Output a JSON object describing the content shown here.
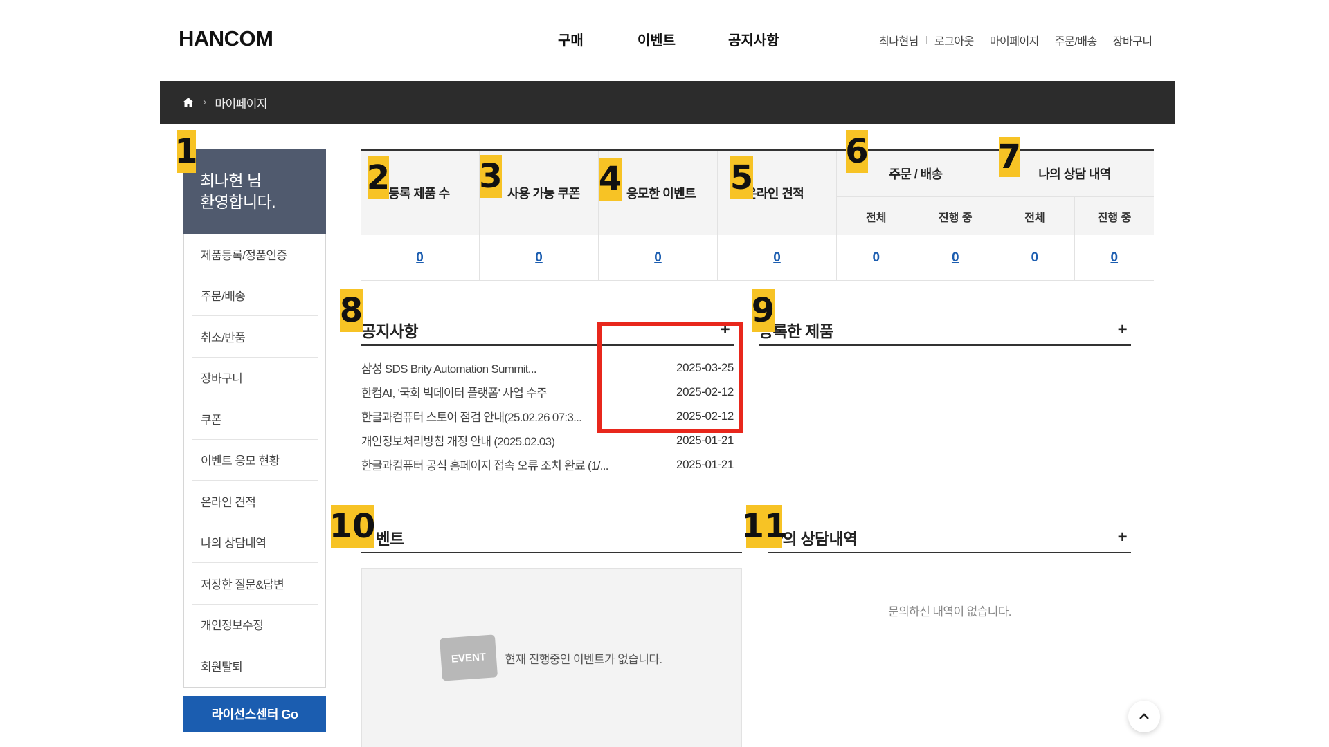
{
  "header": {
    "logo": "HANCOM",
    "nav": [
      "구매",
      "이벤트",
      "공지사항"
    ],
    "util": [
      "최나현님",
      "로그아웃",
      "마이페이지",
      "주문/배송",
      "장바구니"
    ]
  },
  "breadcrumb": {
    "current": "마이페이지"
  },
  "sidebar": {
    "welcome_line1": "최나현 님",
    "welcome_line2": "환영합니다.",
    "items": [
      "제품등록/정품인증",
      "주문/배송",
      "취소/반품",
      "장바구니",
      "쿠폰",
      "이벤트 응모 현황",
      "온라인 견적",
      "나의 상담내역",
      "저장한 질문&답변",
      "개인정보수정",
      "회원탈퇴"
    ],
    "license_button": "라이선스센터 Go"
  },
  "stats": {
    "registered": {
      "label": "등록 제품 수",
      "value": "0"
    },
    "coupons": {
      "label": "사용 가능 쿠폰",
      "value": "0"
    },
    "events": {
      "label": "응모한 이벤트",
      "value": "0"
    },
    "quotes": {
      "label": "온라인 견적",
      "value": "0"
    },
    "orders": {
      "label": "주문 / 배송",
      "all_label": "전체",
      "progress_label": "진행 중",
      "all": "0",
      "progress": "0"
    },
    "consult": {
      "label": "나의 상담 내역",
      "all_label": "전체",
      "progress_label": "진행 중",
      "all": "0",
      "progress": "0"
    }
  },
  "notice": {
    "title": "공지사항",
    "plus": "+",
    "items": [
      {
        "title": "삼성 SDS Brity Automation Summit...",
        "date": "2025-03-25"
      },
      {
        "title": "한컴AI, '국회 빅데이터 플랫폼' 사업 수주",
        "date": "2025-02-12"
      },
      {
        "title": "한글과컴퓨터 스토어 점검 안내(25.02.26 07:3...",
        "date": "2025-02-12"
      },
      {
        "title": "개인정보처리방침 개정 안내 (2025.02.03)",
        "date": "2025-01-21"
      },
      {
        "title": "한글과컴퓨터 공식 홈페이지 접속 오류 조치 완료 (1/...",
        "date": "2025-01-21"
      }
    ]
  },
  "products": {
    "title": "등록한 제품",
    "plus": "+"
  },
  "events": {
    "title": "이벤트",
    "badge": "EVENT",
    "empty": "현재 진행중인 이벤트가 없습니다."
  },
  "consult": {
    "title": "나의 상담내역",
    "plus": "+",
    "empty": "문의하신 내역이 없습니다."
  },
  "annotations": [
    "1",
    "2",
    "3",
    "4",
    "5",
    "6",
    "7",
    "8",
    "9",
    "10",
    "11"
  ],
  "colors": {
    "accent_blue": "#1b5db0",
    "welcome_bg": "#505a6e",
    "tag_yellow": "#f7c325",
    "highlight_red": "#e8271c"
  }
}
